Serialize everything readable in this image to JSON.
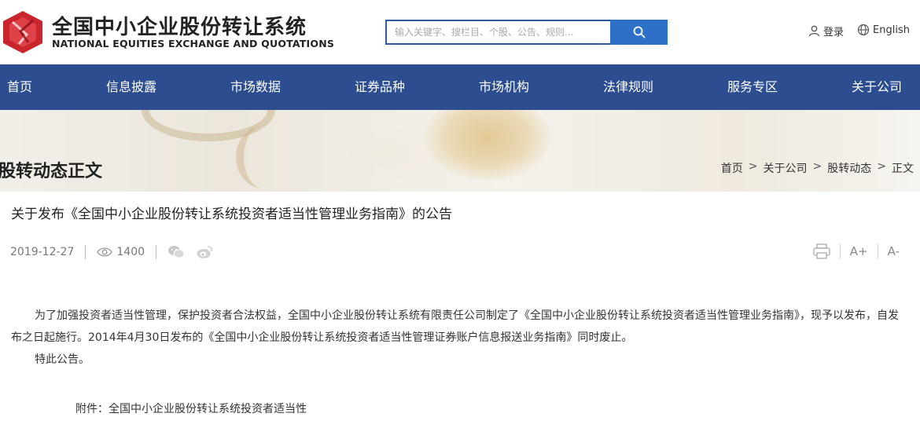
{
  "header": {
    "logo_cn": "全国中小企业股份转让系统",
    "logo_en": "NATIONAL EQUITIES EXCHANGE AND QUOTATIONS",
    "search_placeholder": "输入关键字、搜栏目、个股、公告、规则...",
    "login_label": "登录",
    "language_label": "English",
    "brand_color": "#c8252c"
  },
  "nav": {
    "items": [
      "首页",
      "信息披露",
      "市场数据",
      "证券品种",
      "市场机构",
      "法律规则",
      "服务专区",
      "关于公司"
    ],
    "background": "#2c4d8f"
  },
  "page": {
    "heading": "股转动态正文",
    "breadcrumb": [
      "首页",
      "关于公司",
      "股转动态",
      "正文"
    ],
    "breadcrumb_separator": ">"
  },
  "article": {
    "title": "关于发布《全国中小企业股份转让系统投资者适当性管理业务指南》的公告",
    "date": "2019-12-27",
    "views": "1400",
    "share_icons": [
      "wechat-icon",
      "weibo-icon"
    ],
    "tools": {
      "print_icon": "print-icon",
      "font_increase": "A+",
      "font_decrease": "A-"
    },
    "paragraphs": [
      "为了加强投资者适当性管理，保护投资者合法权益，全国中小企业股份转让系统有限责任公司制定了《全国中小企业股份转让系统投资者适当性管理业务指南》，现予以发布，自发布之日起施行。2014年4月30日发布的《全国中小企业股份转让系统投资者适当性管理证券账户信息报送业务指南》同时废止。",
      "特此公告。"
    ],
    "attachment": "附件：全国中小企业股份转让系统投资者适当性"
  }
}
